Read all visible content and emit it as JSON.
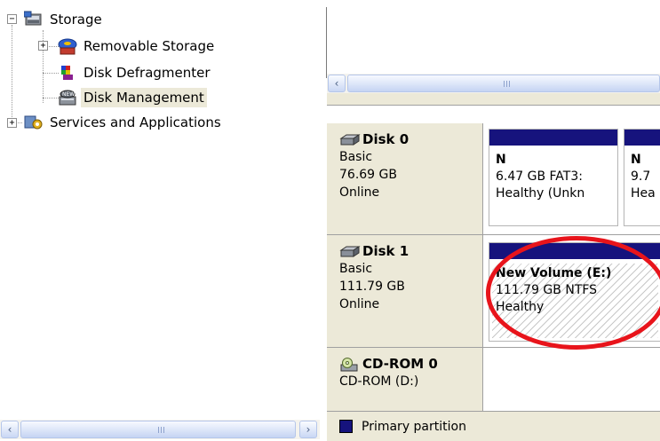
{
  "tree": {
    "storage": {
      "label": "Storage",
      "expander": "−"
    },
    "removable_storage": {
      "label": "Removable Storage",
      "expander": "+"
    },
    "disk_defragmenter": {
      "label": "Disk Defragmenter"
    },
    "disk_management": {
      "label": "Disk Management"
    },
    "services_and_applications": {
      "label": "Services and Applications",
      "expander": "+"
    }
  },
  "scroll": {
    "left_arrow": "‹",
    "right_arrow": "›"
  },
  "disks": [
    {
      "name": "Disk 0",
      "type": "Basic",
      "size": "76.69 GB",
      "status": "Online",
      "partitions": [
        {
          "title": "N",
          "detail": "6.47 GB FAT3:",
          "health": "Healthy (Unkn"
        },
        {
          "title": "N",
          "detail": "9.7",
          "health": "Hea"
        }
      ]
    },
    {
      "name": "Disk 1",
      "type": "Basic",
      "size": "111.79 GB",
      "status": "Online",
      "partitions": [
        {
          "title": "New Volume  (E:)",
          "detail": "111.79 GB NTFS",
          "health": "Healthy"
        }
      ]
    }
  ],
  "cdrom": {
    "name": "CD-ROM 0",
    "drive": "CD-ROM (D:)"
  },
  "legend": {
    "label": "Primary partition"
  },
  "colors": {
    "primary_partition": "#16137d",
    "highlight": "#e8141b",
    "selection": "#ece9d8"
  }
}
